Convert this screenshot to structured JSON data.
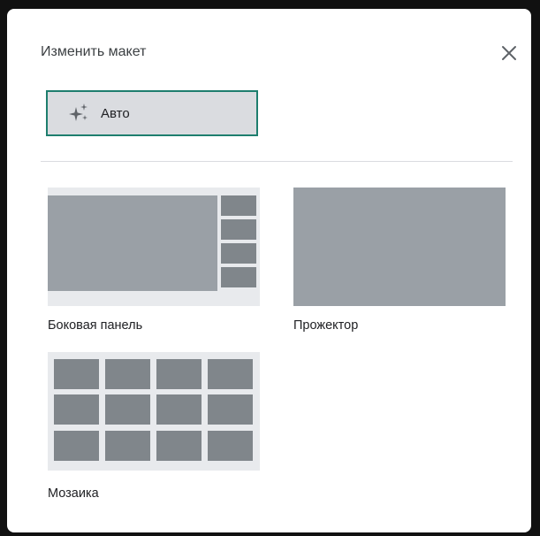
{
  "dialog": {
    "title": "Изменить макет",
    "close_icon": "close-icon"
  },
  "auto_button": {
    "label": "Авто",
    "icon": "sparkle-icon",
    "selected": true,
    "accent_color": "#1e7e6e"
  },
  "layouts": [
    {
      "label": "Боковая панель",
      "thumbnail": "sidebar-layout-thumbnail"
    },
    {
      "label": "Прожектор",
      "thumbnail": "spotlight-layout-thumbnail"
    },
    {
      "label": "Мозаика",
      "thumbnail": "tiled-layout-thumbnail"
    }
  ],
  "colors": {
    "thumb_bg": "#e8eaed",
    "main_video": "#9aa0a6",
    "tile": "#80868b",
    "selected_bg": "#dadce0"
  }
}
